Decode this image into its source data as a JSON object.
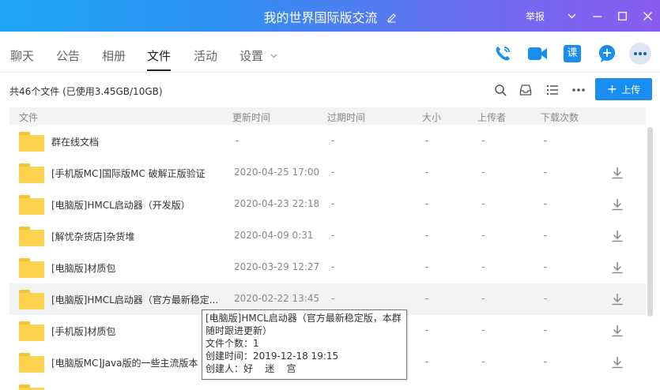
{
  "window": {
    "title": "我的世界国际版交流",
    "report_label": "举报"
  },
  "tabs": [
    {
      "label": "聊天"
    },
    {
      "label": "公告"
    },
    {
      "label": "相册"
    },
    {
      "label": "文件"
    },
    {
      "label": "活动"
    },
    {
      "label": "设置"
    }
  ],
  "toolbar": {
    "course_label": "课",
    "summary": "共46个文件 (已使用3.45GB/10GB)",
    "upload_label": "上传"
  },
  "table": {
    "headers": [
      "文件",
      "更新时间",
      "过期时间",
      "大小",
      "上传者",
      "下载次数"
    ],
    "rows": [
      {
        "name": "群在线文档",
        "updated": "-",
        "expires": "-",
        "size": "-",
        "uploader": "-",
        "downloads": "-"
      },
      {
        "name": "[手机版MC]国际版MC 破解正版验证",
        "updated": "2020-04-25 17:00",
        "expires": "-",
        "size": "-",
        "uploader": "-",
        "downloads": "-"
      },
      {
        "name": "[电脑版]HMCL启动器（开发版）",
        "updated": "2020-04-23 22:18",
        "expires": "-",
        "size": "-",
        "uploader": "-",
        "downloads": "-"
      },
      {
        "name": "[解忧杂货店]杂货堆",
        "updated": "2020-04-09 0:31",
        "expires": "-",
        "size": "-",
        "uploader": "-",
        "downloads": "-"
      },
      {
        "name": "[电脑版]材质包",
        "updated": "2020-03-29 12:27",
        "expires": "-",
        "size": "-",
        "uploader": "-",
        "downloads": "-"
      },
      {
        "name": "[电脑版]HMCL启动器（官方最新稳定...",
        "updated": "2020-02-22 13:45",
        "expires": "-",
        "size": "-",
        "uploader": "-",
        "downloads": "-"
      },
      {
        "name": "[手机版]材质包",
        "updated": "",
        "expires": "-",
        "size": "-",
        "uploader": "-",
        "downloads": "-"
      },
      {
        "name": "[电脑版MC]Java版的一些主流版本",
        "updated": "",
        "expires": "-",
        "size": "-",
        "uploader": "-",
        "downloads": "-"
      }
    ]
  },
  "tooltip": {
    "line1": "[电脑版]HMCL启动器（官方最新稳定版，本群",
    "line2": "随时跟进更新）",
    "line3": "文件个数：1",
    "line4": "创建时间：2019-12-18 19:15",
    "line5": "创建人：好    迷    宫"
  },
  "colors": {
    "accent": "#1a8ef0",
    "folder": "#fcd24d",
    "header_bg": "#f2f3f5"
  }
}
